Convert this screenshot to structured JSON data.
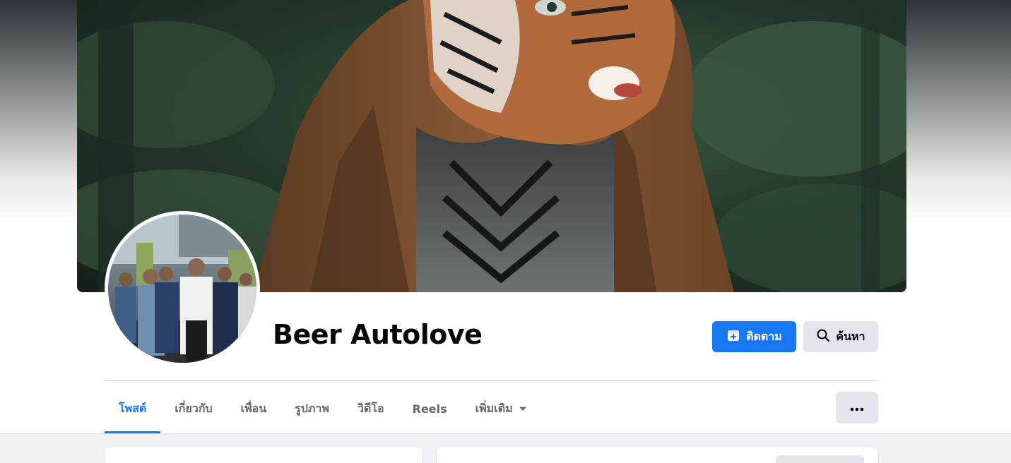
{
  "profile": {
    "name": "Beer Autolove"
  },
  "actions": {
    "follow_label": "ติดตาม",
    "search_label": "ค้นหา",
    "more_icon": "more-horizontal-icon"
  },
  "tabs": [
    {
      "label": "โพสต์",
      "active": true
    },
    {
      "label": "เกี่ยวกับ",
      "active": false
    },
    {
      "label": "เพื่อน",
      "active": false
    },
    {
      "label": "รูปภาพ",
      "active": false
    },
    {
      "label": "วิดีโอ",
      "active": false
    },
    {
      "label": "Reels",
      "active": false
    },
    {
      "label": "เพิ่มเติม",
      "active": false,
      "dropdown": true
    }
  ],
  "colors": {
    "accent": "#1877f2",
    "secondary_button": "#e4e6eb",
    "tab_inactive": "#65676b",
    "text": "#050505",
    "page_bg": "#f0f2f5"
  }
}
